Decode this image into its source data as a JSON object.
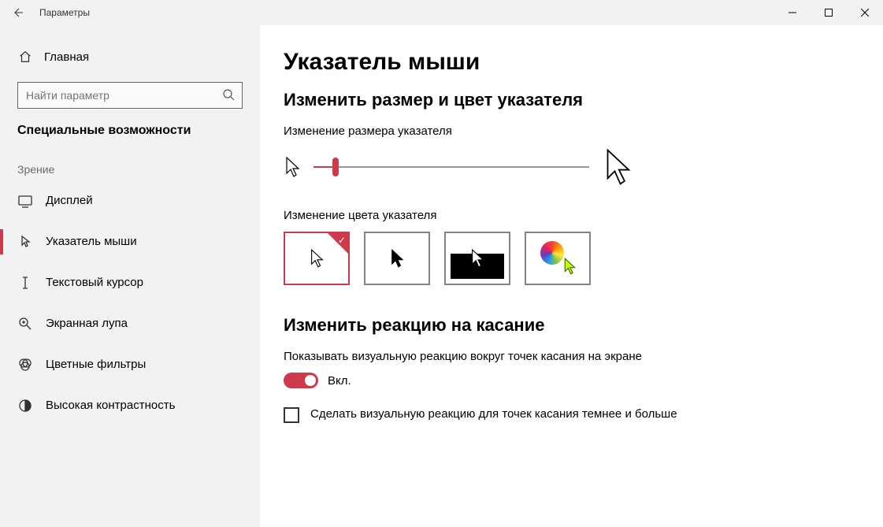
{
  "app": {
    "title": "Параметры"
  },
  "sidebar": {
    "home_label": "Главная",
    "search_placeholder": "Найти параметр",
    "category_header": "Специальные возможности",
    "section_label": "Зрение",
    "items": [
      {
        "label": "Дисплей",
        "icon": "display"
      },
      {
        "label": "Указатель мыши",
        "icon": "pointer",
        "active": true
      },
      {
        "label": "Текстовый курсор",
        "icon": "text-cursor"
      },
      {
        "label": "Экранная лупа",
        "icon": "magnifier"
      },
      {
        "label": "Цветные фильтры",
        "icon": "color-filters"
      },
      {
        "label": "Высокая контрастность",
        "icon": "contrast"
      }
    ]
  },
  "main": {
    "page_title": "Указатель мыши",
    "section1_title": "Изменить размер и цвет указателя",
    "size_label": "Изменение размера указателя",
    "color_label": "Изменение цвета указателя",
    "section2_title": "Изменить реакцию на касание",
    "touch_feedback_label": "Показывать визуальную реакцию вокруг точек касания на экране",
    "toggle_on_text": "Вкл.",
    "checkbox_label": "Сделать визуальную реакцию для точек касания темнее и больше",
    "slider_percent": 8,
    "color_options": [
      {
        "name": "white",
        "selected": true
      },
      {
        "name": "black"
      },
      {
        "name": "inverted"
      },
      {
        "name": "custom"
      }
    ],
    "toggle_state": "on",
    "checkbox_state": "unchecked"
  }
}
